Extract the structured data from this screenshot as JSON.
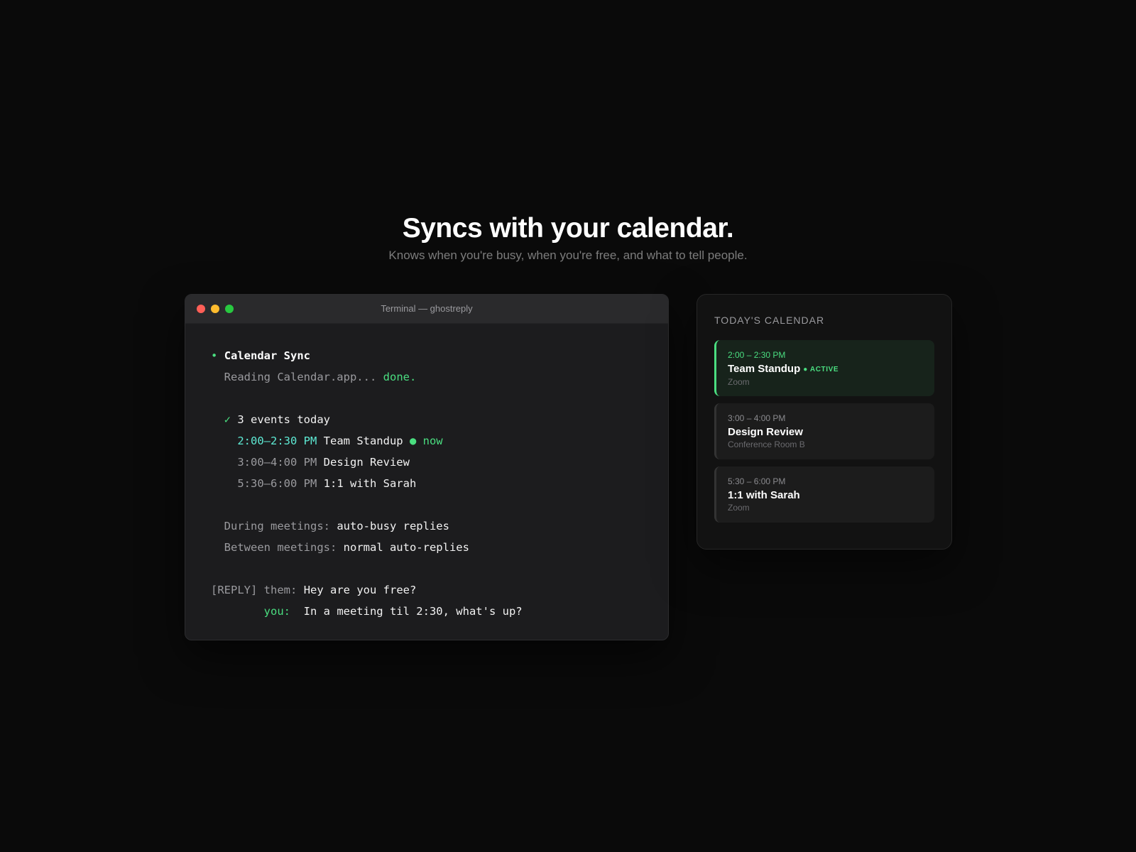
{
  "hero": {
    "title": "Syncs with your calendar.",
    "subtitle": "Knows when you're busy, when you're free, and what to tell people."
  },
  "terminal": {
    "window_title": "Terminal — ghostreply",
    "section_bullet": "•",
    "section_title": "Calendar Sync",
    "reading_text": "Reading Calendar.app...",
    "reading_status": "done.",
    "check_mark": "✓",
    "events_summary": "3 events today",
    "events": [
      {
        "time": "2:00–2:30 PM",
        "name": "Team Standup",
        "now_marker": "● now"
      },
      {
        "time": "3:00–4:00 PM",
        "name": "Design Review"
      },
      {
        "time": "5:30–6:00 PM",
        "name": "1:1 with Sarah"
      }
    ],
    "during_label": "During meetings:",
    "during_value": "auto-busy replies",
    "between_label": "Between meetings:",
    "between_value": "normal auto-replies",
    "reply_tag": "[REPLY]",
    "them_label": "them:",
    "them_text": "Hey are you free?",
    "you_label": "you:",
    "you_text": "In a meeting til 2:30, what's up?"
  },
  "calendar": {
    "heading": "TODAY'S CALENDAR",
    "events": [
      {
        "time": "2:00 – 2:30 PM",
        "title": "Team Standup",
        "badge": "● ACTIVE",
        "location": "Zoom"
      },
      {
        "time": "3:00 – 4:00 PM",
        "title": "Design Review",
        "location": "Conference Room B"
      },
      {
        "time": "5:30 – 6:00 PM",
        "title": "1:1 with Sarah",
        "location": "Zoom"
      }
    ]
  },
  "colors": {
    "background": "#0a0a0a",
    "accent_green": "#4ade80",
    "accent_cyan": "#5eead4",
    "terminal_bg": "#1c1c1e"
  }
}
